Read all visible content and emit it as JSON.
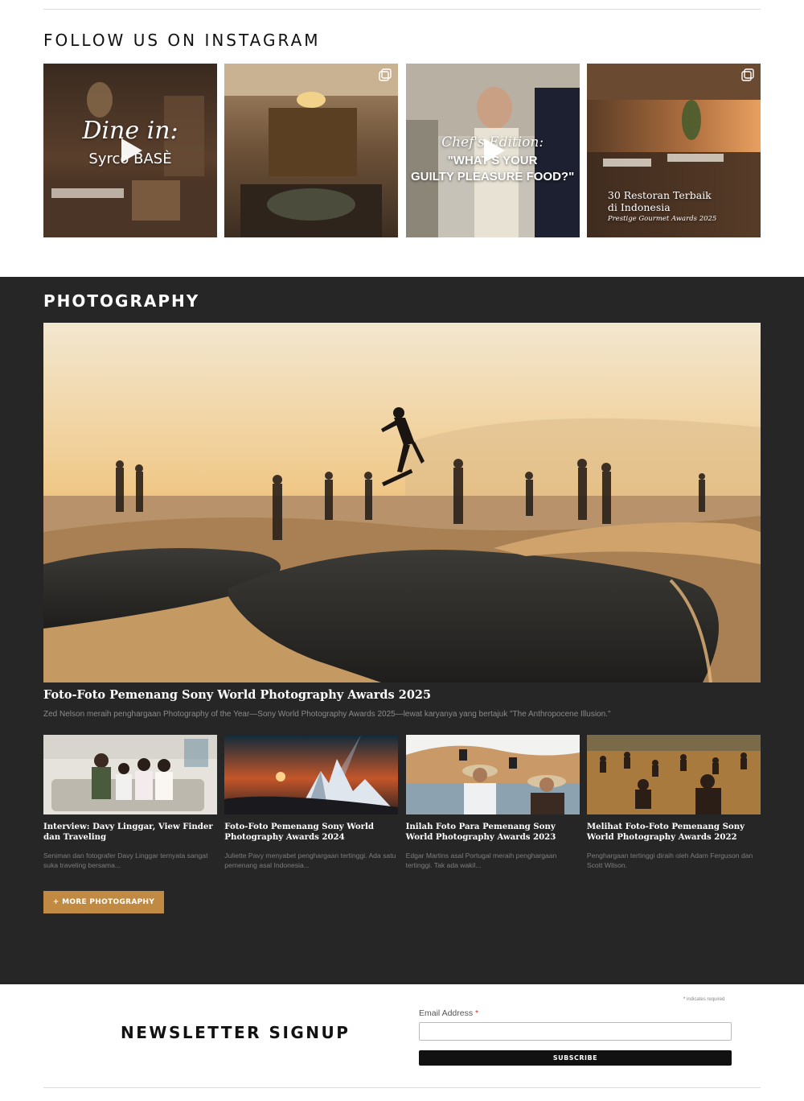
{
  "instagram": {
    "title": "FOLLOW US ON INSTAGRAM",
    "posts": [
      {
        "type": "video",
        "line1": "Dine in:",
        "line2": "Syrco BASÈ"
      },
      {
        "type": "carousel"
      },
      {
        "type": "video",
        "line1": "Chef's Edition:",
        "line2": "\"WHAT'S YOUR",
        "line3": "GUILTY PLEASURE FOOD?\""
      },
      {
        "type": "carousel",
        "line1": "30 Restoran Terbaik",
        "line2": "di Indonesia",
        "line3": "Prestige Gourmet Awards 2025"
      }
    ]
  },
  "photography": {
    "title": "PHOTOGRAPHY",
    "featured": {
      "title": "Foto-Foto Pemenang Sony World Photography Awards 2025",
      "excerpt": "Zed Nelson meraih penghargaan Photography of the Year—Sony World Photography Awards 2025—lewat karyanya yang bertajuk \"The Anthropocene Illusion.\""
    },
    "cards": [
      {
        "title": "Interview: Davy Linggar, View Finder dan Traveling",
        "excerpt": "Seniman dan fotografer Davy Linggar ternyata sangat suka traveling bersama..."
      },
      {
        "title": "Foto-Foto Pemenang Sony World Photography Awards 2024",
        "excerpt": "Juliette Pavy menyabet penghargaan tertinggi. Ada satu pemenang asal Indonesia..."
      },
      {
        "title": "Inilah Foto Para Pemenang Sony World Photography Awards 2023",
        "excerpt": "Edgar Martins asal Portugal meraih penghargaan tertinggi. Tak ada wakil..."
      },
      {
        "title": "Melihat Foto-Foto Pemenang Sony World Photography Awards 2022",
        "excerpt": "Penghargaan tertinggi diraih oleh Adam Ferguson dan Scott Wilson."
      }
    ],
    "more_label": "+ MORE PHOTOGRAPHY"
  },
  "newsletter": {
    "title": "NEWSLETTER SIGNUP",
    "required_mark": "*",
    "required_note": "indicates required",
    "email_label": "Email Address",
    "email_value": "",
    "subscribe_label": "SUBSCRIBE"
  },
  "colors": {
    "dark_section": "#262626",
    "accent": "#c18a43",
    "button_dark": "#111111"
  }
}
